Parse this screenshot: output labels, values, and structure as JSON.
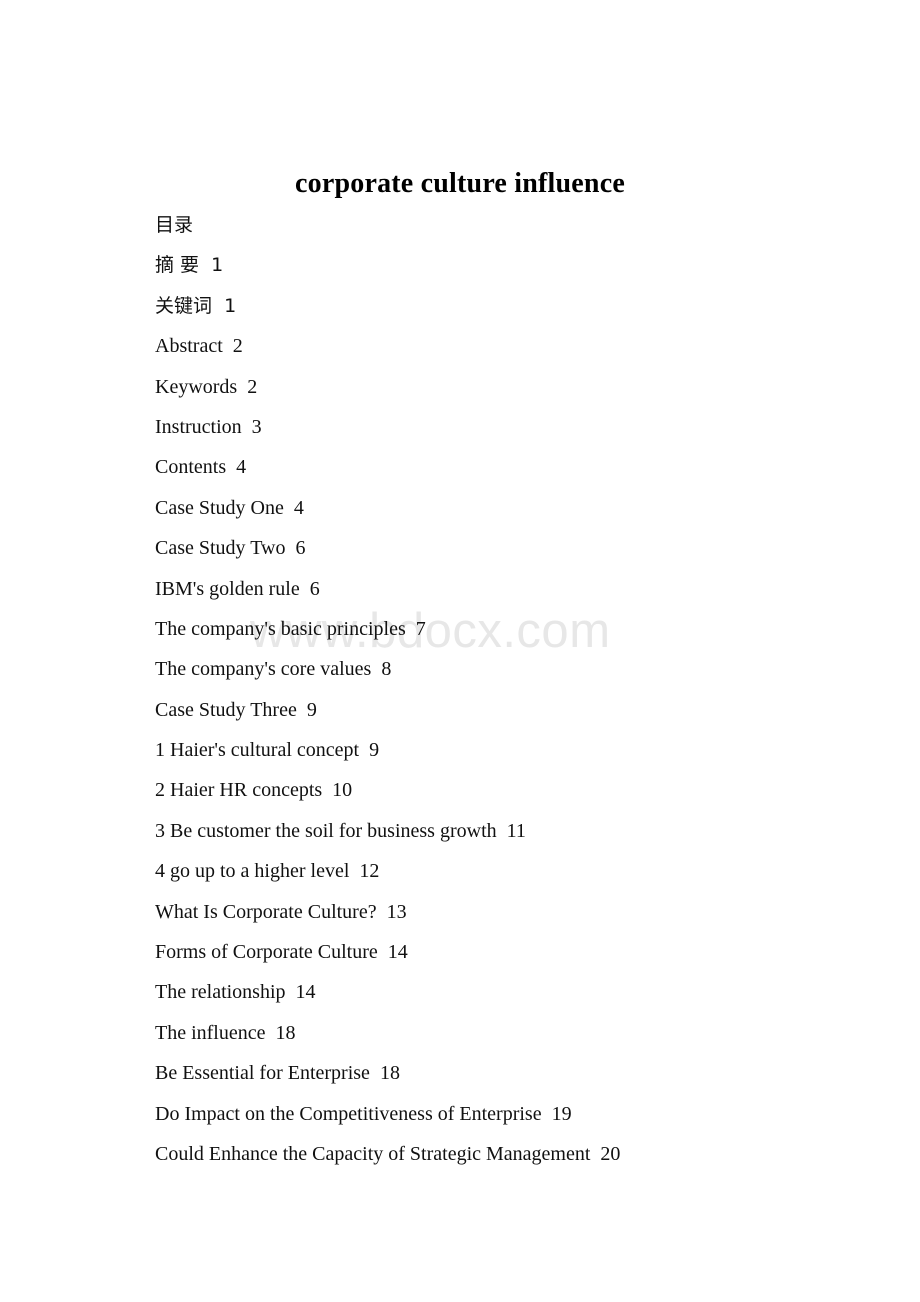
{
  "document": {
    "title": "corporate culture influence",
    "watermark": "www.bdocx.com",
    "background_color": "#ffffff",
    "text_color": "#000000",
    "watermark_color": "#e7e7e7"
  },
  "toc": {
    "heading": "目录",
    "entries": [
      {
        "label": "摘 要",
        "page": "1",
        "cjk": true
      },
      {
        "label": "关键词",
        "page": "1",
        "cjk": true
      },
      {
        "label": "Abstract",
        "page": "2",
        "cjk": false
      },
      {
        "label": "Keywords",
        "page": "2",
        "cjk": false
      },
      {
        "label": "Instruction",
        "page": "3",
        "cjk": false
      },
      {
        "label": "Contents",
        "page": "4",
        "cjk": false
      },
      {
        "label": "Case Study One",
        "page": "4",
        "cjk": false
      },
      {
        "label": "Case Study Two",
        "page": "6",
        "cjk": false
      },
      {
        "label": "IBM's golden rule",
        "page": "6",
        "cjk": false
      },
      {
        "label": "The company's basic principles",
        "page": "7",
        "cjk": false
      },
      {
        "label": "The company's core values",
        "page": "8",
        "cjk": false
      },
      {
        "label": "Case Study Three",
        "page": "9",
        "cjk": false
      },
      {
        "label": "1 Haier's cultural concept",
        "page": "9",
        "cjk": false
      },
      {
        "label": "2 Haier HR concepts",
        "page": "10",
        "cjk": false
      },
      {
        "label": "3 Be customer the soil for business growth",
        "page": "11",
        "cjk": false
      },
      {
        "label": "4 go up to a higher level",
        "page": "12",
        "cjk": false
      },
      {
        "label": "What Is Corporate Culture?",
        "page": "13",
        "cjk": false
      },
      {
        "label": "Forms of Corporate Culture",
        "page": "14",
        "cjk": false
      },
      {
        "label": "The relationship",
        "page": "14",
        "cjk": false
      },
      {
        "label": "The influence",
        "page": "18",
        "cjk": false
      },
      {
        "label": "Be Essential for Enterprise",
        "page": "18",
        "cjk": false
      },
      {
        "label": "Do Impact on the Competitiveness of Enterprise",
        "page": "19",
        "cjk": false
      },
      {
        "label": "Could Enhance the Capacity of Strategic Management",
        "page": "20",
        "cjk": false
      }
    ]
  }
}
